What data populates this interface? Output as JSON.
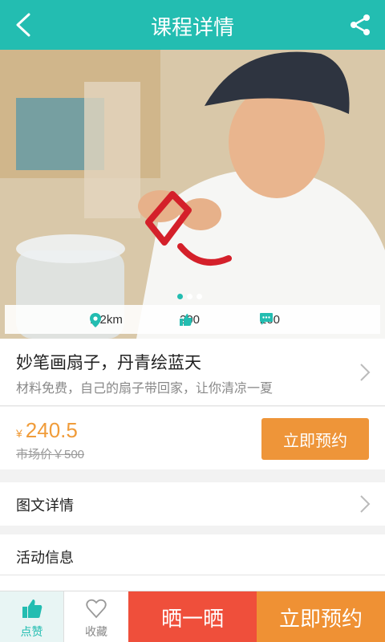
{
  "header": {
    "title": "课程详情",
    "back_icon": "back-chevron-icon",
    "share_icon": "share-icon"
  },
  "hero": {
    "carousel": {
      "count": 3,
      "active_index": 0
    },
    "stats": {
      "distance": "1.2km",
      "likes": "200",
      "comments": "200"
    }
  },
  "course": {
    "name": "妙笔画扇子，丹青绘蓝天",
    "desc": "材料免费，自己的扇子带回家，让你清凉一夏"
  },
  "pricing": {
    "currency": "¥",
    "price": "240.5",
    "market_price": "市场价￥500",
    "book_label": "立即预约"
  },
  "sections": {
    "detail": "图文详情",
    "activity": "活动信息"
  },
  "bottom": {
    "like_label": "点赞",
    "fav_label": "收藏",
    "show_label": "晒一晒",
    "book_label": "立即预约"
  },
  "colors": {
    "primary": "#23bdb1",
    "orange": "#ee9539",
    "red": "#ef4f3b"
  }
}
